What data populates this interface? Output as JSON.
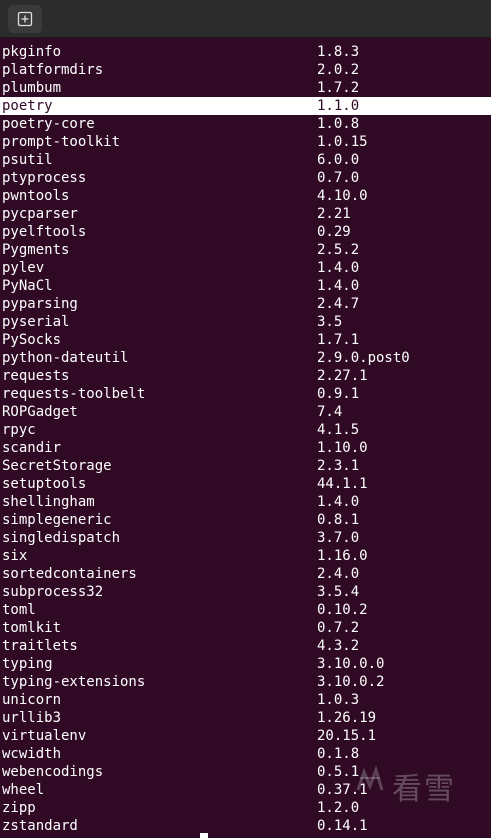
{
  "titlebar": {
    "new_tab_icon": "new-tab-icon"
  },
  "terminal": {
    "background": "#300a24",
    "selected_row": "poetry",
    "packages": [
      {
        "name": "pkginfo",
        "version": "1.8.3"
      },
      {
        "name": "platformdirs",
        "version": "2.0.2"
      },
      {
        "name": "plumbum",
        "version": "1.7.2"
      },
      {
        "name": "poetry",
        "version": "1.1.0"
      },
      {
        "name": "poetry-core",
        "version": "1.0.8"
      },
      {
        "name": "prompt-toolkit",
        "version": "1.0.15"
      },
      {
        "name": "psutil",
        "version": "6.0.0"
      },
      {
        "name": "ptyprocess",
        "version": "0.7.0"
      },
      {
        "name": "pwntools",
        "version": "4.10.0"
      },
      {
        "name": "pycparser",
        "version": "2.21"
      },
      {
        "name": "pyelftools",
        "version": "0.29"
      },
      {
        "name": "Pygments",
        "version": "2.5.2"
      },
      {
        "name": "pylev",
        "version": "1.4.0"
      },
      {
        "name": "PyNaCl",
        "version": "1.4.0"
      },
      {
        "name": "pyparsing",
        "version": "2.4.7"
      },
      {
        "name": "pyserial",
        "version": "3.5"
      },
      {
        "name": "PySocks",
        "version": "1.7.1"
      },
      {
        "name": "python-dateutil",
        "version": "2.9.0.post0"
      },
      {
        "name": "requests",
        "version": "2.27.1"
      },
      {
        "name": "requests-toolbelt",
        "version": "0.9.1"
      },
      {
        "name": "ROPGadget",
        "version": "7.4"
      },
      {
        "name": "rpyc",
        "version": "4.1.5"
      },
      {
        "name": "scandir",
        "version": "1.10.0"
      },
      {
        "name": "SecretStorage",
        "version": "2.3.1"
      },
      {
        "name": "setuptools",
        "version": "44.1.1"
      },
      {
        "name": "shellingham",
        "version": "1.4.0"
      },
      {
        "name": "simplegeneric",
        "version": "0.8.1"
      },
      {
        "name": "singledispatch",
        "version": "3.7.0"
      },
      {
        "name": "six",
        "version": "1.16.0"
      },
      {
        "name": "sortedcontainers",
        "version": "2.4.0"
      },
      {
        "name": "subprocess32",
        "version": "3.5.4"
      },
      {
        "name": "toml",
        "version": "0.10.2"
      },
      {
        "name": "tomlkit",
        "version": "0.7.2"
      },
      {
        "name": "traitlets",
        "version": "4.3.2"
      },
      {
        "name": "typing",
        "version": "3.10.0.0"
      },
      {
        "name": "typing-extensions",
        "version": "3.10.0.2"
      },
      {
        "name": "unicorn",
        "version": "1.0.3"
      },
      {
        "name": "urllib3",
        "version": "1.26.19"
      },
      {
        "name": "virtualenv",
        "version": "20.15.1"
      },
      {
        "name": "wcwidth",
        "version": "0.1.8"
      },
      {
        "name": "webencodings",
        "version": "0.5.1"
      },
      {
        "name": "wheel",
        "version": "0.37.1"
      },
      {
        "name": "zipp",
        "version": "1.2.0"
      },
      {
        "name": "zstandard",
        "version": "0.14.1"
      }
    ]
  },
  "watermark": {
    "text": "看雪"
  }
}
